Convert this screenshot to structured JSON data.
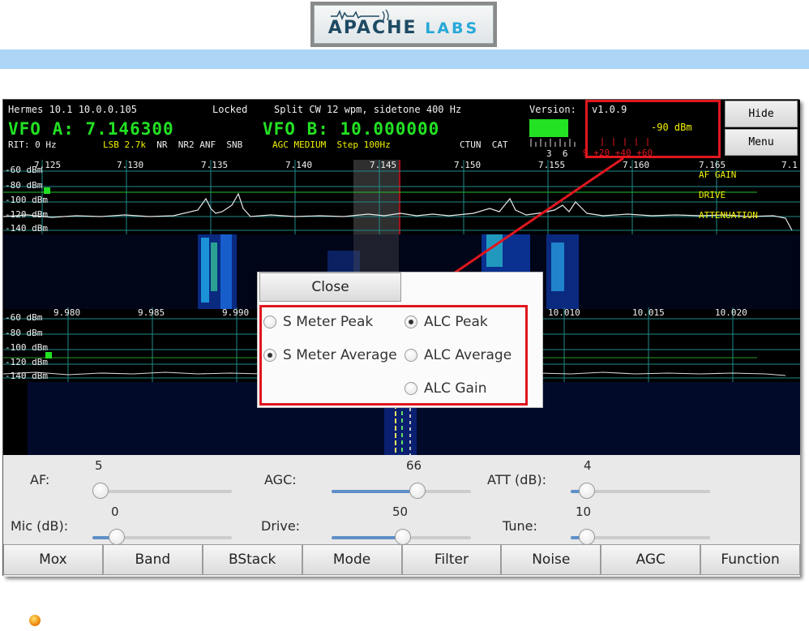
{
  "logo": {
    "word1": "APACHE",
    "word2": "LABS"
  },
  "status": {
    "line1_left": "Hermes 10.1 10.0.0.105",
    "locked": "Locked",
    "split": "Split CW 12 wpm, sidetone 400 Hz",
    "version_label": "Version:",
    "version": "v1.0.9",
    "vfo_a": "VFO A: 7.146300",
    "vfo_b": "VFO B: 10.000000",
    "rit": "RIT: 0 Hz",
    "mode_line": "LSB 2.7k  NR  NR2 ANF  SNB",
    "agc_line": "AGC MEDIUM  Step 100Hz",
    "ctun_cat": "CTUN  CAT"
  },
  "meter": {
    "dbm": "-90 dBm",
    "scale_white": "3  6",
    "scale_red": "9 +20 +40 +60",
    "bar_level": 0.55
  },
  "side_buttons": {
    "hide": "Hide",
    "menu": "Menu"
  },
  "panadapter_a": {
    "freq_ticks": [
      "7.125",
      "7.130",
      "7.135",
      "7.140",
      "7.145",
      "7.150",
      "7.155",
      "7.160",
      "7.165",
      "7.1"
    ],
    "db_ticks": [
      "-60 dBm",
      "-80 dBm",
      "-100 dBm",
      "-120 dBm",
      "-140 dBm"
    ],
    "overlay": [
      "AF GAIN",
      "DRIVE",
      "ATTENUATION"
    ]
  },
  "panadapter_b": {
    "freq_ticks": [
      "9.980",
      "9.985",
      "9.990",
      "10.010",
      "10.015",
      "10.020"
    ],
    "db_ticks": [
      "-60 dBm",
      "-80 dBm",
      "-100 dBm",
      "-120 dBm",
      "-140 dBm"
    ]
  },
  "dialog": {
    "close": "Close",
    "options": [
      {
        "label": "S Meter Peak",
        "checked": false
      },
      {
        "label": "ALC Peak",
        "checked": true
      },
      {
        "label": "S Meter Average",
        "checked": true
      },
      {
        "label": "ALC Average",
        "checked": false
      },
      {
        "label": "ALC Gain",
        "checked": false
      }
    ]
  },
  "sliders": {
    "af": {
      "label": "AF:",
      "value": "5"
    },
    "agc": {
      "label": "AGC:",
      "value": "66"
    },
    "att": {
      "label": "ATT (dB):",
      "value": "4"
    },
    "mic": {
      "label": "Mic (dB):",
      "value": "0"
    },
    "drive": {
      "label": "Drive:",
      "value": "50"
    },
    "tune": {
      "label": "Tune:",
      "value": "10"
    }
  },
  "buttons": [
    "Mox",
    "Band",
    "BStack",
    "Mode",
    "Filter",
    "Noise",
    "AGC",
    "Function"
  ],
  "colors": {
    "accent_red": "#e0161e",
    "vfo_green": "#23e123",
    "label_yellow": "#f2f200",
    "bluebar": "#add5f5"
  }
}
